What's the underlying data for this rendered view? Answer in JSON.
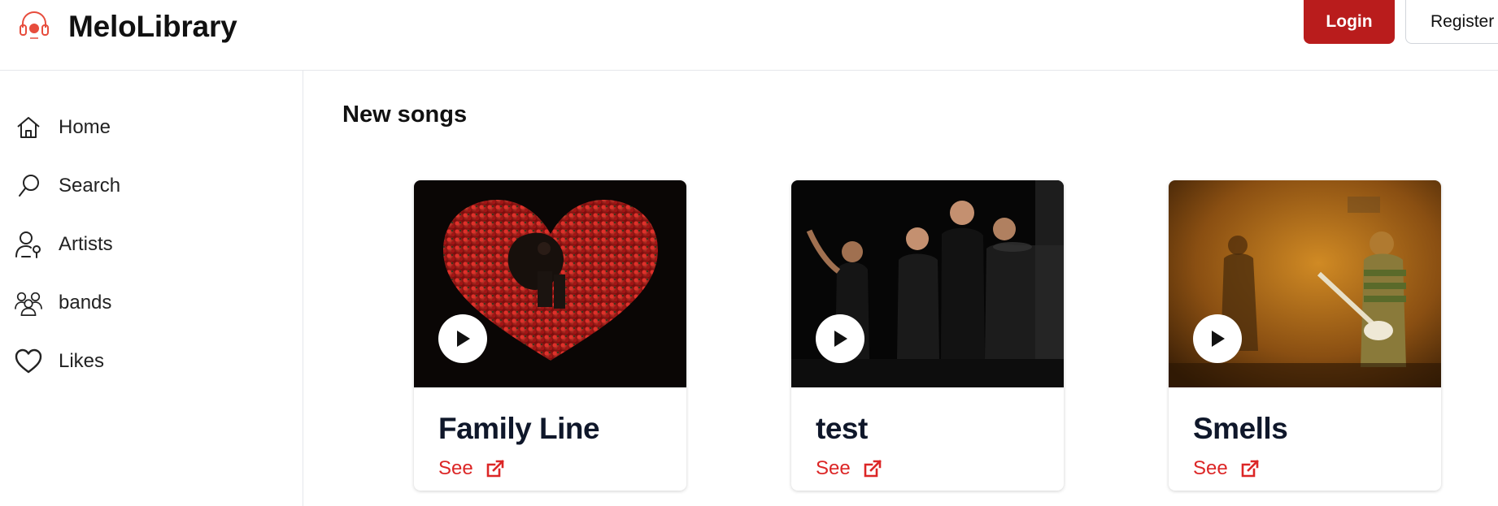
{
  "header": {
    "brand": "MeloLibrary",
    "login_label": "Login",
    "register_label": "Register"
  },
  "sidebar": {
    "items": [
      {
        "label": "Home",
        "icon": "home-icon"
      },
      {
        "label": "Search",
        "icon": "search-icon"
      },
      {
        "label": "Artists",
        "icon": "artist-mic-icon"
      },
      {
        "label": "bands",
        "icon": "users-group-icon"
      },
      {
        "label": "Likes",
        "icon": "heart-icon"
      }
    ]
  },
  "main": {
    "section_title": "New songs",
    "songs": [
      {
        "title": "Family Line",
        "link_label": "See"
      },
      {
        "title": "test",
        "link_label": "See"
      },
      {
        "title": "Smells",
        "link_label": "See"
      }
    ]
  },
  "colors": {
    "accent": "#b91c1c",
    "link": "#dc2626"
  }
}
